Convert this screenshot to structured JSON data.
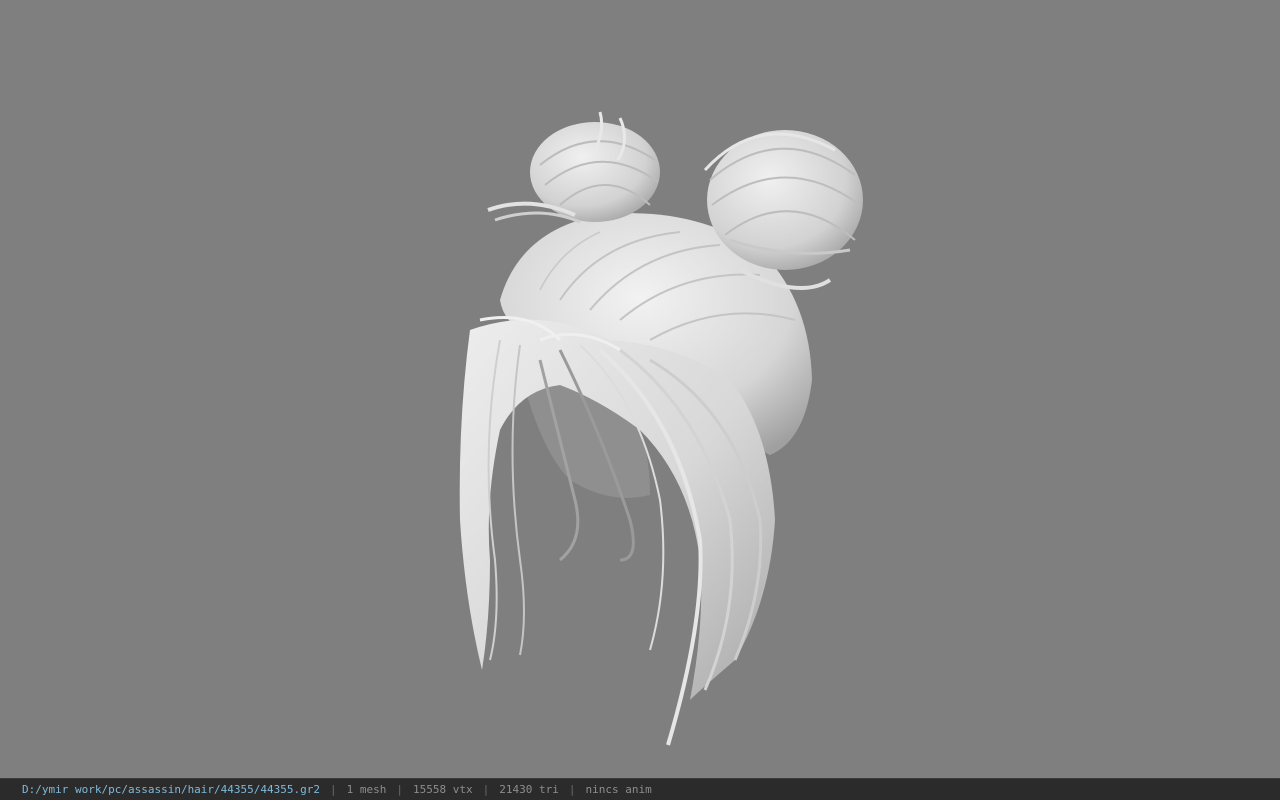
{
  "viewport": {
    "background": "#7f7f7f",
    "model_color": "#dedede",
    "model_shadow": "#8c8c8c"
  },
  "statusbar": {
    "file_path": "D:/ymir work/pc/assassin/hair/44355/44355.gr2",
    "mesh_count": "1 mesh",
    "vertex_count": "15558 vtx",
    "triangle_count": "21430 tri",
    "anim_status": "nincs anim",
    "separator": "|"
  }
}
